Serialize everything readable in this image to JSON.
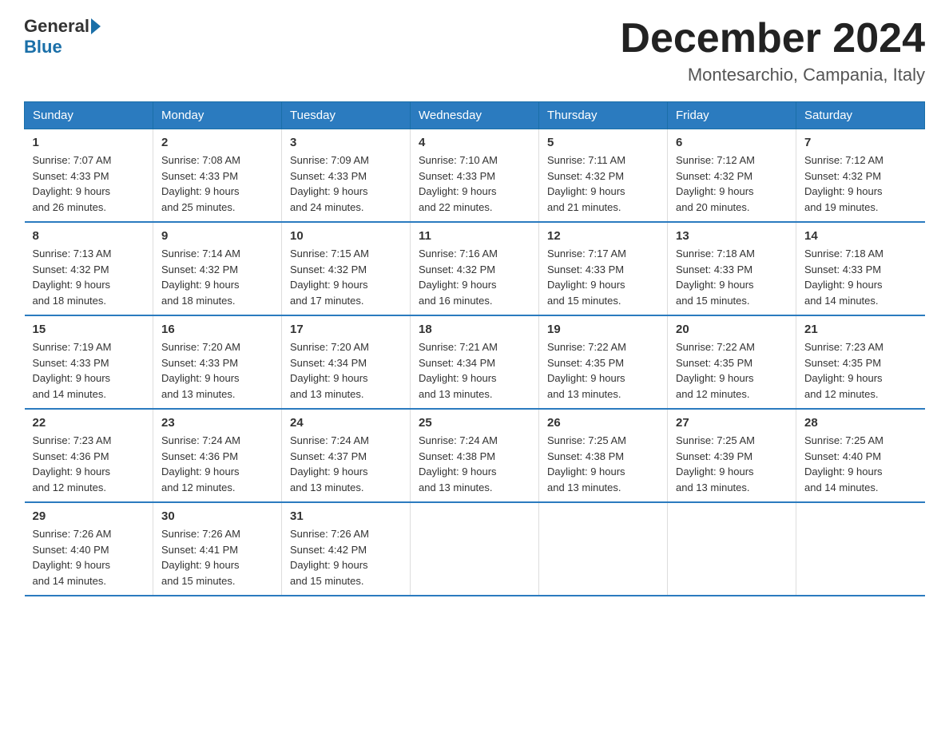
{
  "logo": {
    "general": "General",
    "blue": "Blue"
  },
  "title": "December 2024",
  "location": "Montesarchio, Campania, Italy",
  "days_of_week": [
    "Sunday",
    "Monday",
    "Tuesday",
    "Wednesday",
    "Thursday",
    "Friday",
    "Saturday"
  ],
  "weeks": [
    [
      {
        "day": "1",
        "sunrise": "7:07 AM",
        "sunset": "4:33 PM",
        "daylight": "9 hours and 26 minutes."
      },
      {
        "day": "2",
        "sunrise": "7:08 AM",
        "sunset": "4:33 PM",
        "daylight": "9 hours and 25 minutes."
      },
      {
        "day": "3",
        "sunrise": "7:09 AM",
        "sunset": "4:33 PM",
        "daylight": "9 hours and 24 minutes."
      },
      {
        "day": "4",
        "sunrise": "7:10 AM",
        "sunset": "4:33 PM",
        "daylight": "9 hours and 22 minutes."
      },
      {
        "day": "5",
        "sunrise": "7:11 AM",
        "sunset": "4:32 PM",
        "daylight": "9 hours and 21 minutes."
      },
      {
        "day": "6",
        "sunrise": "7:12 AM",
        "sunset": "4:32 PM",
        "daylight": "9 hours and 20 minutes."
      },
      {
        "day": "7",
        "sunrise": "7:12 AM",
        "sunset": "4:32 PM",
        "daylight": "9 hours and 19 minutes."
      }
    ],
    [
      {
        "day": "8",
        "sunrise": "7:13 AM",
        "sunset": "4:32 PM",
        "daylight": "9 hours and 18 minutes."
      },
      {
        "day": "9",
        "sunrise": "7:14 AM",
        "sunset": "4:32 PM",
        "daylight": "9 hours and 18 minutes."
      },
      {
        "day": "10",
        "sunrise": "7:15 AM",
        "sunset": "4:32 PM",
        "daylight": "9 hours and 17 minutes."
      },
      {
        "day": "11",
        "sunrise": "7:16 AM",
        "sunset": "4:32 PM",
        "daylight": "9 hours and 16 minutes."
      },
      {
        "day": "12",
        "sunrise": "7:17 AM",
        "sunset": "4:33 PM",
        "daylight": "9 hours and 15 minutes."
      },
      {
        "day": "13",
        "sunrise": "7:18 AM",
        "sunset": "4:33 PM",
        "daylight": "9 hours and 15 minutes."
      },
      {
        "day": "14",
        "sunrise": "7:18 AM",
        "sunset": "4:33 PM",
        "daylight": "9 hours and 14 minutes."
      }
    ],
    [
      {
        "day": "15",
        "sunrise": "7:19 AM",
        "sunset": "4:33 PM",
        "daylight": "9 hours and 14 minutes."
      },
      {
        "day": "16",
        "sunrise": "7:20 AM",
        "sunset": "4:33 PM",
        "daylight": "9 hours and 13 minutes."
      },
      {
        "day": "17",
        "sunrise": "7:20 AM",
        "sunset": "4:34 PM",
        "daylight": "9 hours and 13 minutes."
      },
      {
        "day": "18",
        "sunrise": "7:21 AM",
        "sunset": "4:34 PM",
        "daylight": "9 hours and 13 minutes."
      },
      {
        "day": "19",
        "sunrise": "7:22 AM",
        "sunset": "4:35 PM",
        "daylight": "9 hours and 13 minutes."
      },
      {
        "day": "20",
        "sunrise": "7:22 AM",
        "sunset": "4:35 PM",
        "daylight": "9 hours and 12 minutes."
      },
      {
        "day": "21",
        "sunrise": "7:23 AM",
        "sunset": "4:35 PM",
        "daylight": "9 hours and 12 minutes."
      }
    ],
    [
      {
        "day": "22",
        "sunrise": "7:23 AM",
        "sunset": "4:36 PM",
        "daylight": "9 hours and 12 minutes."
      },
      {
        "day": "23",
        "sunrise": "7:24 AM",
        "sunset": "4:36 PM",
        "daylight": "9 hours and 12 minutes."
      },
      {
        "day": "24",
        "sunrise": "7:24 AM",
        "sunset": "4:37 PM",
        "daylight": "9 hours and 13 minutes."
      },
      {
        "day": "25",
        "sunrise": "7:24 AM",
        "sunset": "4:38 PM",
        "daylight": "9 hours and 13 minutes."
      },
      {
        "day": "26",
        "sunrise": "7:25 AM",
        "sunset": "4:38 PM",
        "daylight": "9 hours and 13 minutes."
      },
      {
        "day": "27",
        "sunrise": "7:25 AM",
        "sunset": "4:39 PM",
        "daylight": "9 hours and 13 minutes."
      },
      {
        "day": "28",
        "sunrise": "7:25 AM",
        "sunset": "4:40 PM",
        "daylight": "9 hours and 14 minutes."
      }
    ],
    [
      {
        "day": "29",
        "sunrise": "7:26 AM",
        "sunset": "4:40 PM",
        "daylight": "9 hours and 14 minutes."
      },
      {
        "day": "30",
        "sunrise": "7:26 AM",
        "sunset": "4:41 PM",
        "daylight": "9 hours and 15 minutes."
      },
      {
        "day": "31",
        "sunrise": "7:26 AM",
        "sunset": "4:42 PM",
        "daylight": "9 hours and 15 minutes."
      },
      null,
      null,
      null,
      null
    ]
  ]
}
